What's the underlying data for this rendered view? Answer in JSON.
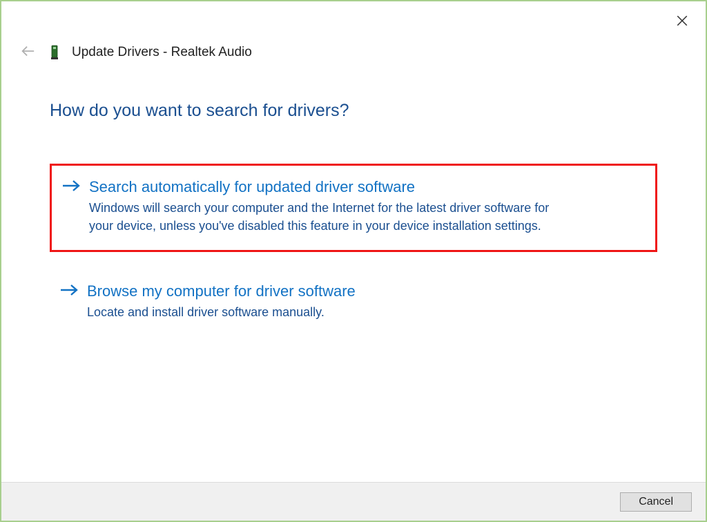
{
  "window": {
    "title": "Update Drivers - Realtek Audio"
  },
  "heading": "How do you want to search for drivers?",
  "options": [
    {
      "title": "Search automatically for updated driver software",
      "description": "Windows will search your computer and the Internet for the latest driver software for your device, unless you've disabled this feature in your device installation settings."
    },
    {
      "title": "Browse my computer for driver software",
      "description": "Locate and install driver software manually."
    }
  ],
  "footer": {
    "cancel_label": "Cancel"
  }
}
